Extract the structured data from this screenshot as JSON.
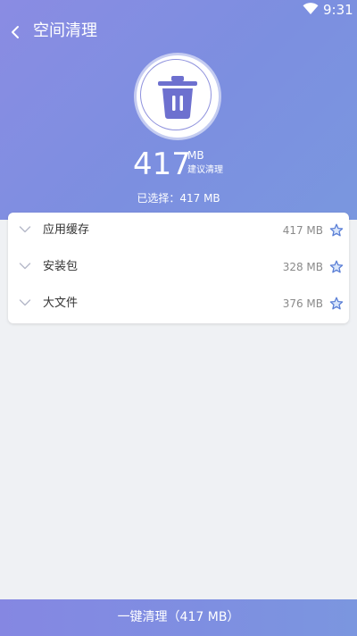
{
  "status_bar": {
    "time": "9:31",
    "wifi_icon": "wifi-icon"
  },
  "header": {
    "title": "空间清理",
    "back_icon": "chevron-left-icon"
  },
  "summary": {
    "trash_icon": "trash-icon",
    "size_value": "417",
    "size_unit": "MB",
    "size_hint": "建议清理",
    "selected_text": "已选择：417 MB"
  },
  "items": [
    {
      "label": "应用缓存",
      "size": "417 MB",
      "expand_icon": "chevron-down-icon",
      "select_icon": "star-icon"
    },
    {
      "label": "安装包",
      "size": "328 MB",
      "expand_icon": "chevron-down-icon",
      "select_icon": "star-icon"
    },
    {
      "label": "大文件",
      "size": "376 MB",
      "expand_icon": "chevron-down-icon",
      "select_icon": "star-icon"
    }
  ],
  "action": {
    "clean_button_label": "一键清理（417 MB）"
  },
  "colors": {
    "header_gradient_start": "#8a8ce3",
    "header_gradient_end": "#7a97df",
    "accent": "#6d70cf",
    "star_outline": "#5b7fd6",
    "star_fill": "#dbe7fb",
    "page_background": "#eff1f4"
  }
}
